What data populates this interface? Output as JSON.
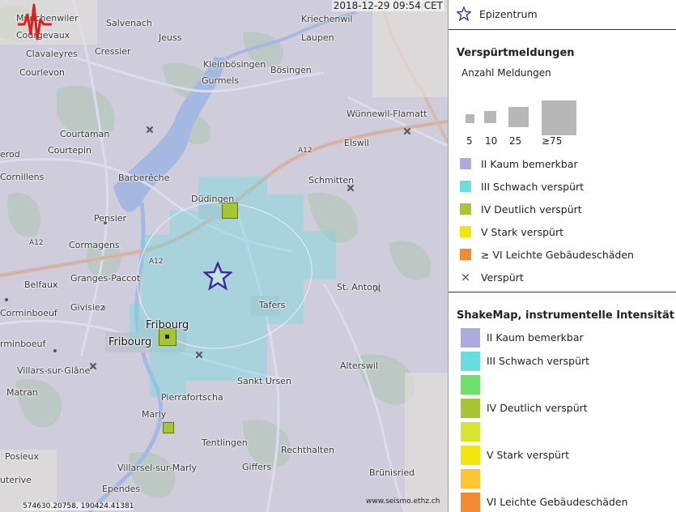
{
  "timestamp": "2018-12-29 09:54 CET",
  "coordinates": "574630.20758, 190424.41381",
  "logo_text": "www.seismo.ethz.ch",
  "places": {
    "muenchenwiler": "Münchenwiler",
    "salvenach": "Salvenach",
    "kriechenwil": "Kriechenwil",
    "courgevaux": "Courgevaux",
    "jeuss": "Jeuss",
    "laupen": "Laupen",
    "clavaleyres": "Clavaleyres",
    "cressier": "Cressier",
    "kleinboesingen": "Kleinbösingen",
    "boesingen": "Bösingen",
    "courlevon": "Courlevon",
    "gurmels": "Gurmels",
    "wuennewil": "Wünnewil-Flamatt",
    "courtaman": "Courtaman",
    "courtepin": "Courtepin",
    "elswil": "Elswil",
    "erod": "erod",
    "cornillens": "Cornillens",
    "barbereche": "Barberêche",
    "schmitten": "Schmitten",
    "duedingen": "Düdingen",
    "pensier": "Pensier",
    "cormagens": "Cormagens",
    "granges": "Granges-Paccot",
    "belfaux": "Belfaux",
    "givisiez": "Givisiez",
    "corminboeuf_n": "Corminboeuf",
    "fribourg_top": "Fribourg",
    "fribourg_left": "Fribourg",
    "tafers": "Tafers",
    "stantoni": "St. Antoni",
    "corminboeuf_s": "rminboeuf",
    "villars": "Villars-sur-Glâne",
    "alterswil": "Alterswil",
    "matran": "Matran",
    "pierrafortscha": "Pierrafortscha",
    "sanktursen": "Sankt Ursen",
    "marly": "Marly",
    "tentlingen": "Tentlingen",
    "rechthalten": "Rechthalten",
    "posieux": "Posieux",
    "giffers": "Giffers",
    "villarsel": "Villarsel-sur-Marly",
    "bruenisried": "Brünisried",
    "uterive": "uterive",
    "ependes": "Ependes",
    "a12_1": "A12",
    "a12_2": "A12",
    "a12_3": "A12"
  },
  "legend": {
    "epicenter_label": "Epizentrum",
    "reports_title": "Verspürtmeldungen",
    "count_title": "Anzahl Meldungen",
    "sizes": [
      "5",
      "10",
      "25",
      "≥75"
    ],
    "felt_items": [
      {
        "label": "II Kaum bemerkbar",
        "color": "#ababdd"
      },
      {
        "label": "III Schwach verspürt",
        "color": "#69dede"
      },
      {
        "label": "IV Deutlich verspürt",
        "color": "#a7c535"
      },
      {
        "label": "V Stark verspürt",
        "color": "#f2e60c"
      },
      {
        "label": "≥ VI Leichte Gebäudeschäden",
        "color": "#f28a2f"
      }
    ],
    "felt_marker_label": "Verspürt",
    "shakemap_title": "ShakeMap, instrumentelle Intensität",
    "shakemap_items": [
      {
        "label": "II Kaum bemerkbar",
        "color": "#ababdd"
      },
      {
        "label": "III Schwach verspürt",
        "color": "#69dede"
      },
      {
        "label": "",
        "color": "#6ddf6d"
      },
      {
        "label": "IV Deutlich verspürt",
        "color": "#a7c535"
      },
      {
        "label": "",
        "color": "#d6e52e"
      },
      {
        "label": "V Stark verspürt",
        "color": "#f2e60c"
      },
      {
        "label": "",
        "color": "#fcc531"
      },
      {
        "label": "VI Leichte Gebäudeschäden",
        "color": "#f28a2f"
      }
    ]
  }
}
